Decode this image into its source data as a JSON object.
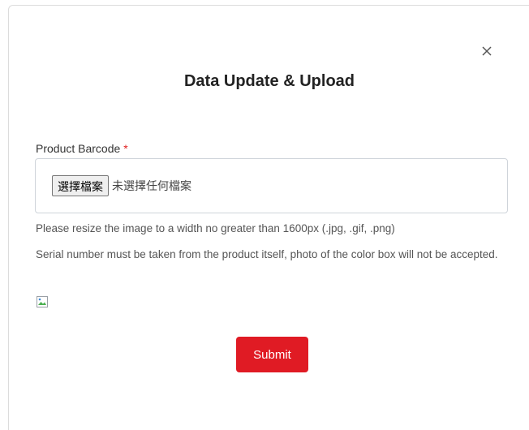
{
  "modal": {
    "title": "Data Update & Upload",
    "close_icon": "close-icon"
  },
  "form": {
    "field_label": "Product Barcode",
    "required_marker": "*",
    "file_button_label": "選擇檔案",
    "file_status": "未選擇任何檔案",
    "help_resize": "Please resize the image to a width no greater than 1600px (.jpg, .gif, .png)",
    "help_serial": "Serial number must be taken from the product itself, photo of the color box will not be accepted.",
    "preview_icon": "broken-image-icon",
    "submit_label": "Submit"
  },
  "colors": {
    "accent": "#e01b24",
    "required": "#e02020"
  }
}
